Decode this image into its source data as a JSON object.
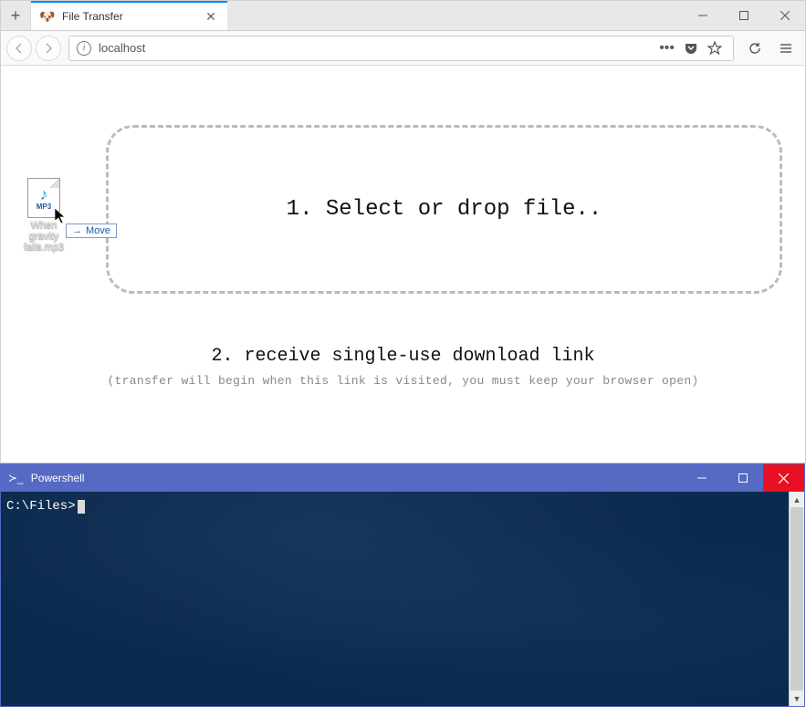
{
  "browser": {
    "tab": {
      "title": "File Transfer",
      "favicon": "🐶"
    },
    "url": "localhost",
    "page": {
      "drop_zone_text": "1. Select or drop file..",
      "step2_heading": "2. receive single-use download link",
      "step2_note": "(transfer will begin when this link is visited, you must keep your browser open)"
    }
  },
  "dragged_file": {
    "name": "When gravity fails.mp3",
    "ext_label": "MP3",
    "tooltip": "Move"
  },
  "powershell": {
    "title": "Powershell",
    "prompt": "C:\\Files>"
  }
}
